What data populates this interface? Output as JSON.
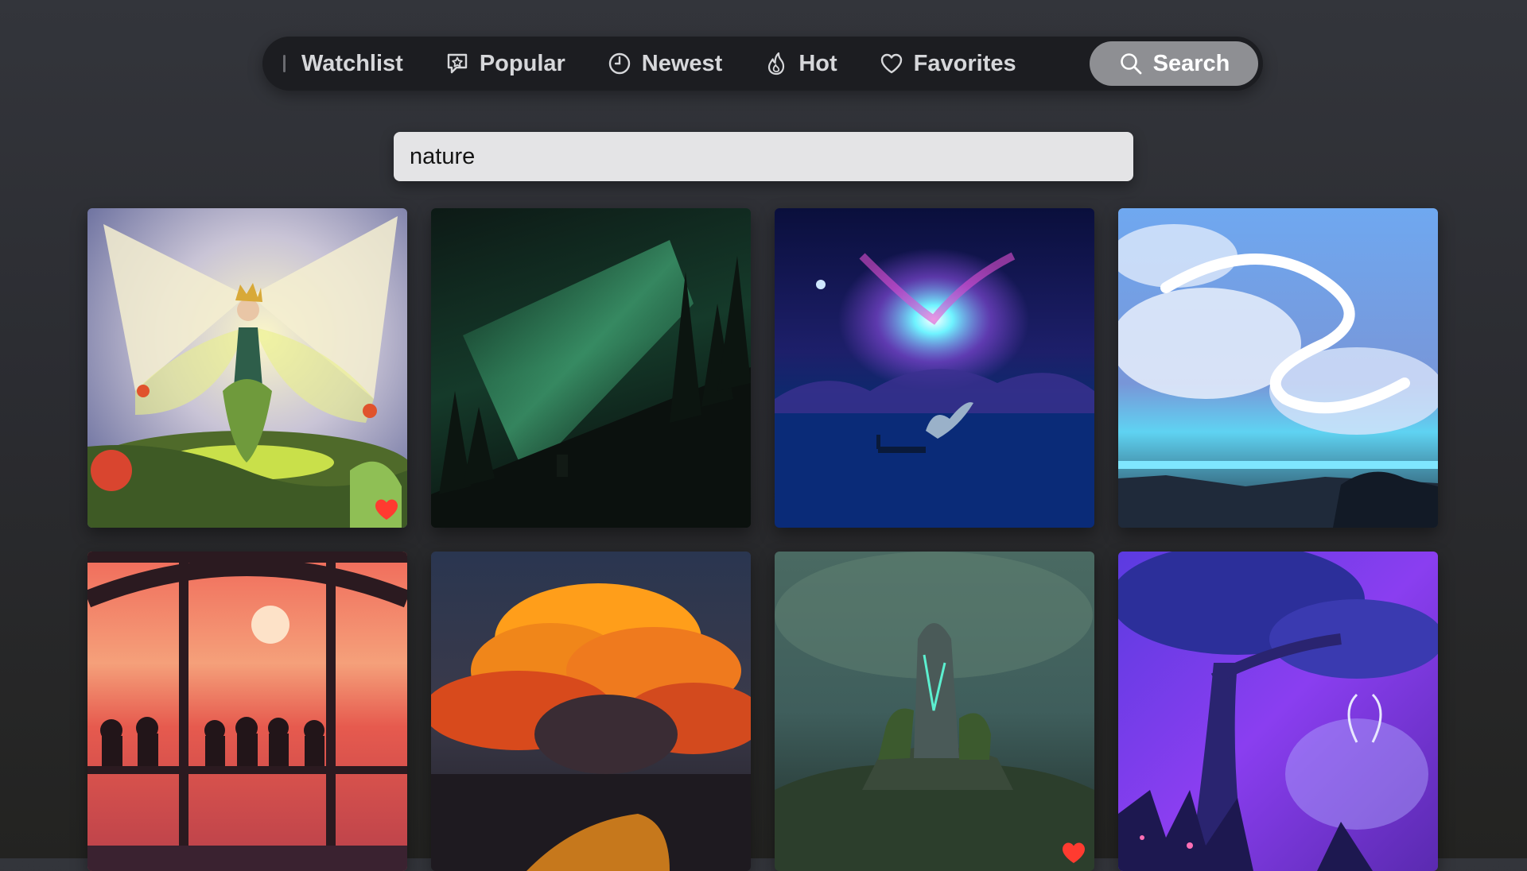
{
  "nav": {
    "items": [
      {
        "label": "Watchlist",
        "icon": "watchlist-icon"
      },
      {
        "label": "Popular",
        "icon": "star-bubble-icon"
      },
      {
        "label": "Newest",
        "icon": "clock-icon"
      },
      {
        "label": "Hot",
        "icon": "flame-icon"
      },
      {
        "label": "Favorites",
        "icon": "heart-icon"
      },
      {
        "label": "Search",
        "icon": "search-icon",
        "active": true
      }
    ]
  },
  "search": {
    "value": "nature"
  },
  "colors": {
    "favorite": "#ff3b30",
    "active_tab": "#8e8f93",
    "search_field": "#e4e4e6"
  },
  "results": [
    {
      "subject": "fairy-queen",
      "favorite": true
    },
    {
      "subject": "green-aurora-forest",
      "favorite": false
    },
    {
      "subject": "whale-aurora-night",
      "favorite": false
    },
    {
      "subject": "cloud-dragon-sky",
      "favorite": false
    },
    {
      "subject": "sunset-bridge-friends",
      "favorite": false
    },
    {
      "subject": "orange-cloud-sunset",
      "favorite": false
    },
    {
      "subject": "glowing-stone-island",
      "favorite": true
    },
    {
      "subject": "purple-tree-spirit-deer",
      "favorite": false
    }
  ]
}
